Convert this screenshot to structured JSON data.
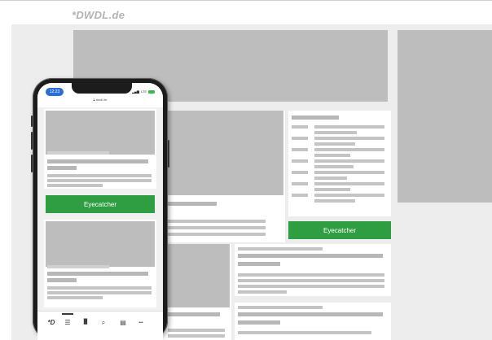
{
  "header": {
    "logo_text": "*DWDL.de"
  },
  "desktop": {
    "eyecatcher_label": "Eyecatcher"
  },
  "phone": {
    "status_time": "12:23",
    "status_network": "LTE",
    "url": "dwdl.de",
    "eyecatcher_label": "Eyecatcher",
    "tabbar": {
      "logo_glyph": "*D",
      "list_glyph": "☰",
      "chart_glyph": "▐▌",
      "search_glyph": "⌕",
      "jobs_glyph": "▤",
      "more_glyph": "•••"
    }
  },
  "colors": {
    "eyecatcher_green": "#2f9e42",
    "placeholder_gray": "#bdbdbd",
    "background_gray": "#ededed",
    "logo_gray": "#b3b3b3",
    "status_pill_blue": "#2a6fd6"
  }
}
